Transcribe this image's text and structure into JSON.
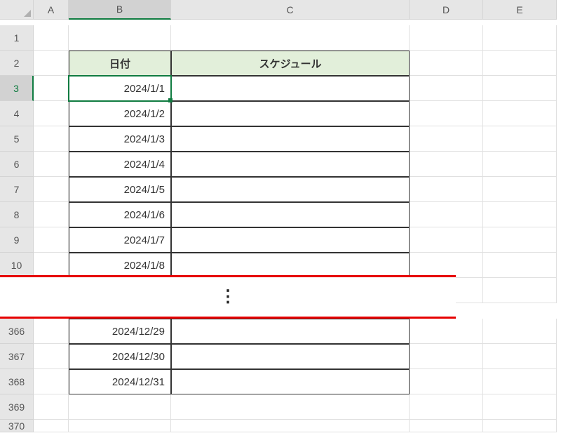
{
  "columns": [
    "A",
    "B",
    "C",
    "D",
    "E"
  ],
  "active_column": "B",
  "top_rows": [
    {
      "num": "1",
      "b": "",
      "c": "",
      "active": false,
      "header": false
    },
    {
      "num": "2",
      "b": "日付",
      "c": "スケジュール",
      "active": false,
      "header": true
    },
    {
      "num": "3",
      "b": "2024/1/1",
      "c": "",
      "active": true,
      "header": false
    },
    {
      "num": "4",
      "b": "2024/1/2",
      "c": "",
      "active": false,
      "header": false
    },
    {
      "num": "5",
      "b": "2024/1/3",
      "c": "",
      "active": false,
      "header": false
    },
    {
      "num": "6",
      "b": "2024/1/4",
      "c": "",
      "active": false,
      "header": false
    },
    {
      "num": "7",
      "b": "2024/1/5",
      "c": "",
      "active": false,
      "header": false
    },
    {
      "num": "8",
      "b": "2024/1/6",
      "c": "",
      "active": false,
      "header": false
    },
    {
      "num": "9",
      "b": "2024/1/7",
      "c": "",
      "active": false,
      "header": false
    },
    {
      "num": "10",
      "b": "2024/1/8",
      "c": "",
      "active": false,
      "header": false
    }
  ],
  "bottom_rows": [
    {
      "num": "366",
      "b": "2024/12/29",
      "c": ""
    },
    {
      "num": "367",
      "b": "2024/12/30",
      "c": ""
    },
    {
      "num": "368",
      "b": "2024/12/31",
      "c": ""
    },
    {
      "num": "369",
      "b": "",
      "c": ""
    },
    {
      "num": "370",
      "b": "",
      "c": ""
    }
  ],
  "ellipsis": "⋮"
}
